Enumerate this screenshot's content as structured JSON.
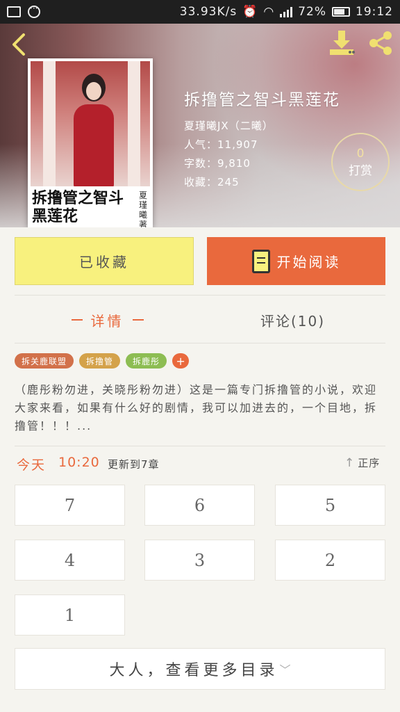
{
  "status_bar": {
    "network_speed": "33.93K/s",
    "battery": "72%",
    "time": "19:12"
  },
  "header": {
    "back_icon": "back-arrow-icon",
    "download_icon": "download-icon",
    "share_icon": "share-icon"
  },
  "book": {
    "cover_title": "拆撸管之智斗黑莲花",
    "cover_author": "夏瑾曦著",
    "title": "拆撸管之智斗黑莲花",
    "author": "夏瑾曦JX（二曦）",
    "popularity": "人气：11,907",
    "word_count": "字数：9,810",
    "favorites": "收藏：245"
  },
  "tip": {
    "count": "0",
    "label": "打赏"
  },
  "actions": {
    "collected_label": "已收藏",
    "read_label": "开始阅读"
  },
  "tabs": {
    "details": "详情",
    "comments": "评论(10)"
  },
  "tags": [
    {
      "label": "拆关鹿联盟",
      "color": "#d2714a"
    },
    {
      "label": "拆撸管",
      "color": "#d4a24a"
    },
    {
      "label": "拆鹿彤",
      "color": "#8dbd53"
    }
  ],
  "tag_add_label": "+",
  "description": "（鹿彤粉勿进，关晓彤粉勿进）这是一篇专门拆撸管的小说，欢迎大家来看，如果有什么好的剧情，我可以加进去的，一个目地，拆撸管！！！...",
  "update": {
    "day": "今天",
    "time": "10:20",
    "text": "更新到7章",
    "sort_label": "正序"
  },
  "chapters": [
    "7",
    "6",
    "5",
    "4",
    "3",
    "2",
    "1"
  ],
  "more_label": "大人，查看更多目录",
  "colors": {
    "accent": "#e9693d",
    "collected_bg": "#f8f17e"
  }
}
